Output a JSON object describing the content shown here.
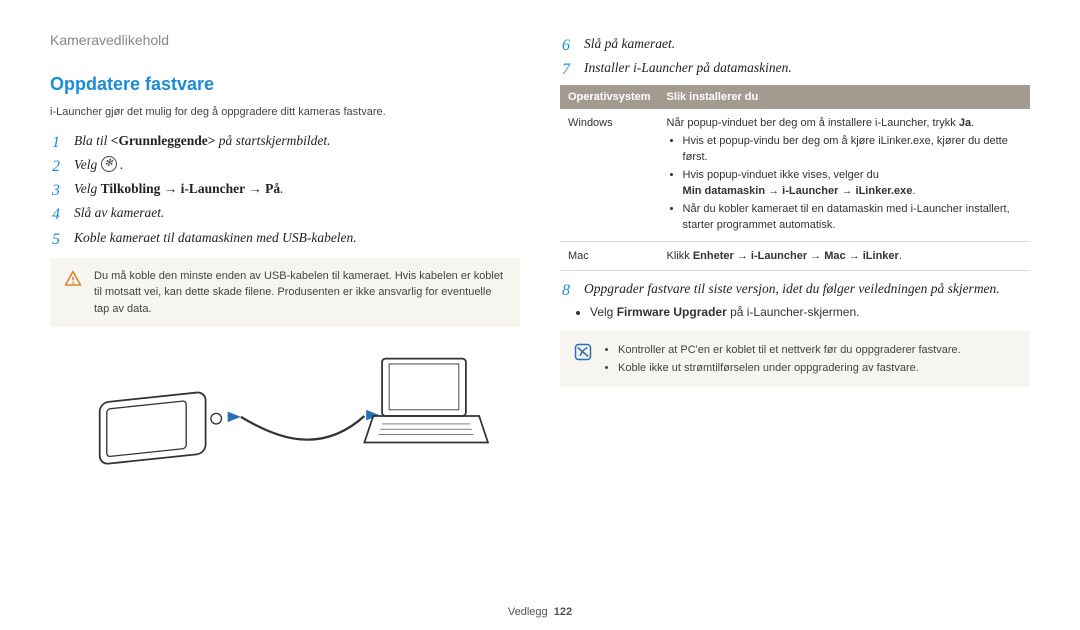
{
  "header": {
    "breadcrumb": "Kameravedlikehold"
  },
  "left": {
    "title": "Oppdatere fastvare",
    "intro": "i-Launcher gjør det mulig for deg å oppgradere ditt kameras fastvare.",
    "steps": {
      "s1_pre": "Bla til ",
      "s1_bold": "<Grunnleggende>",
      "s1_post": " på startskjermbildet.",
      "s2": "Velg ",
      "s3_pre": "Velg ",
      "s3_bold": "Tilkobling → i-Launcher → På",
      "s3_post": ".",
      "s4": "Slå av kameraet.",
      "s5": "Koble kameraet til datamaskinen med USB-kabelen."
    },
    "warn": "Du må koble den minste enden av USB-kabelen til kameraet. Hvis kabelen er koblet til motsatt vei, kan dette skade filene. Produsenten er ikke ansvarlig for eventuelle tap av data."
  },
  "right": {
    "steps_a": {
      "s6": "Slå på kameraet.",
      "s7": "Installer i-Launcher på datamaskinen."
    },
    "table": {
      "h1": "Operativsystem",
      "h2": "Slik installerer du",
      "windows_label": "Windows",
      "win_line1_pre": "Når popup-vinduet ber deg om å installere i-Launcher, trykk ",
      "win_line1_bold": "Ja",
      "win_line1_post": ".",
      "win_b1": "Hvis et popup-vindu ber deg om å kjøre iLinker.exe, kjører du dette først.",
      "win_b2_pre": "Hvis popup-vinduet ikke vises, velger du ",
      "win_b2_bold": "Min datamaskin → i-Launcher → iLinker.exe",
      "win_b2_post": ".",
      "win_b3": "Når du kobler kameraet til en datamaskin med i-Launcher installert, starter programmet automatisk.",
      "mac_label": "Mac",
      "mac_pre": "Klikk ",
      "mac_bold": "Enheter → i-Launcher → Mac → iLinker",
      "mac_post": "."
    },
    "steps_b": {
      "s8": "Oppgrader fastvare til siste versjon, idet du følger veiledningen på skjermen."
    },
    "s8_bullet_pre": "Velg ",
    "s8_bullet_bold": "Firmware Upgrader",
    "s8_bullet_post": " på i-Launcher-skjermen.",
    "note_b1": "Kontroller at PC'en er koblet til et nettverk før du oppgraderer fastvare.",
    "note_b2": "Koble ikke ut strømtilførselen under oppgradering av fastvare."
  },
  "footer": {
    "section": "Vedlegg",
    "page": "122"
  }
}
